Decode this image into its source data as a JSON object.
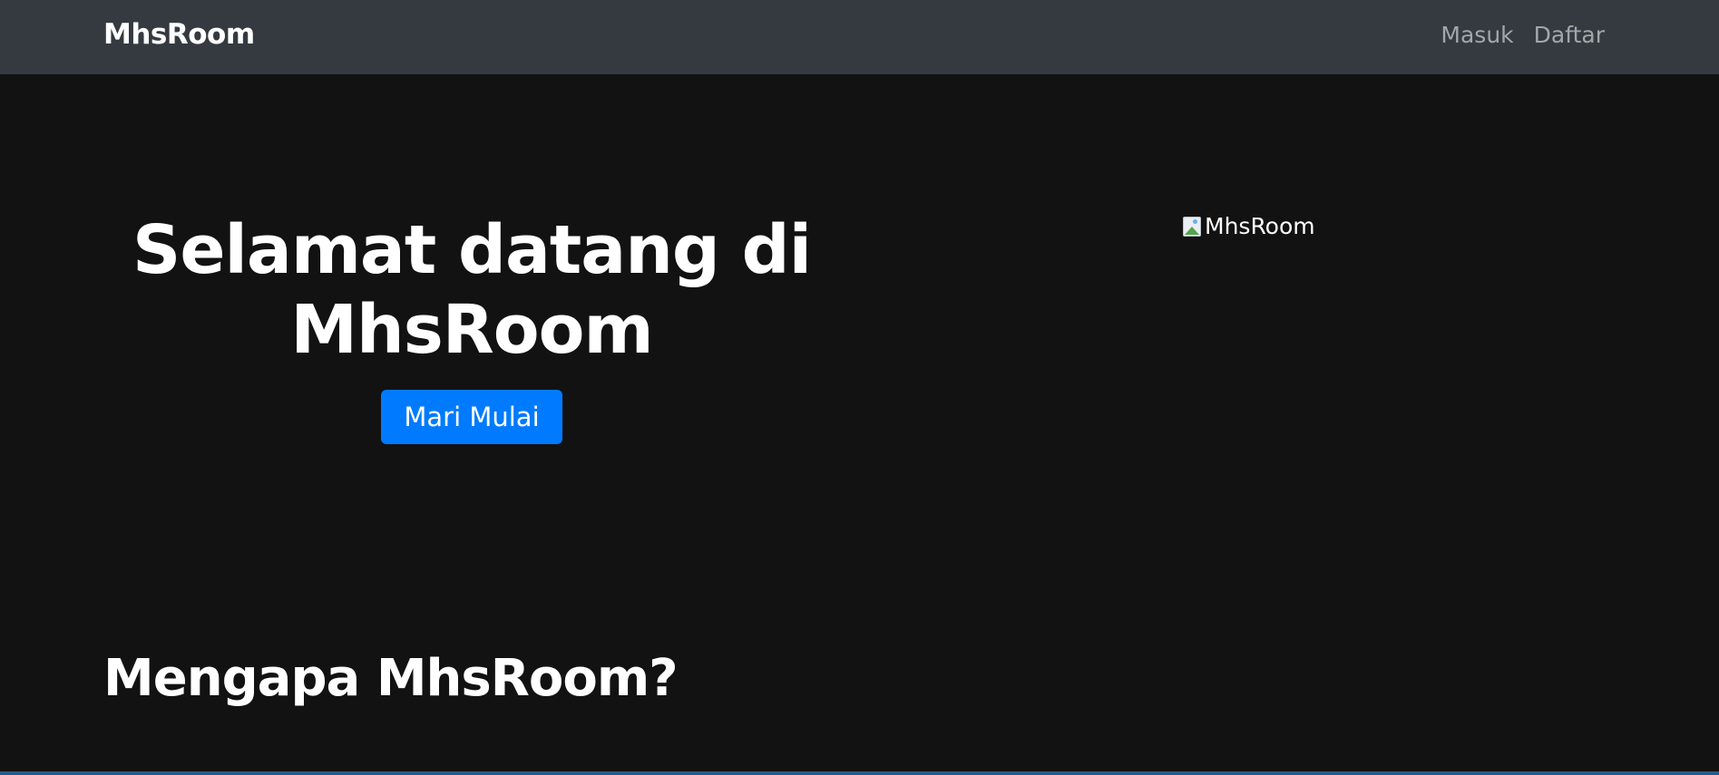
{
  "navbar": {
    "brand": "MhsRoom",
    "links": [
      {
        "label": "Masuk"
      },
      {
        "label": "Daftar"
      }
    ]
  },
  "hero": {
    "title": "Selamat datang di MhsRoom",
    "cta_label": "Mari Mulai",
    "image_alt": "MhsRoom"
  },
  "section": {
    "title": "Mengapa MhsRoom?"
  },
  "colors": {
    "navbar_bg": "#343a40",
    "page_bg": "#121212",
    "accent": "#007bff"
  }
}
